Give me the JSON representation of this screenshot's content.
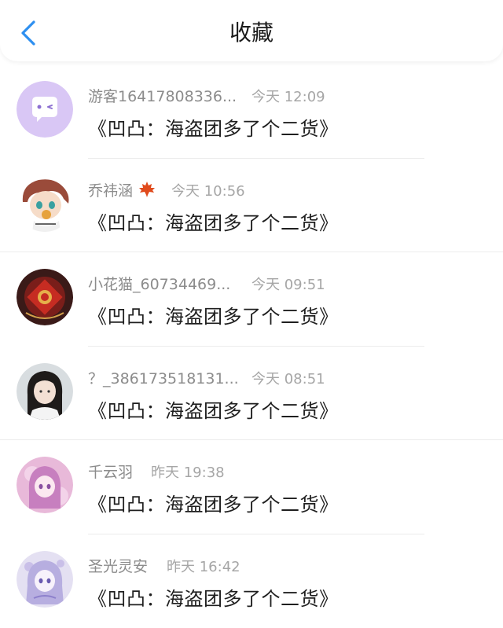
{
  "header": {
    "title": "收藏",
    "back_icon": "chevron-left-icon",
    "accent_color": "#2e8ff0"
  },
  "favorites": [
    {
      "username": "游客16417808336...",
      "time": "今天 12:09",
      "content": "《凹凸：海盗团多了个二货》",
      "avatar": "guest-chat-bubble-avatar"
    },
    {
      "username": "乔祎涵",
      "badge": "maple-leaf-icon",
      "time": "今天 10:56",
      "content": "《凹凸：海盗团多了个二货》",
      "avatar": "anime-boy-avatar"
    },
    {
      "username": "小花猫_60734469...",
      "time": "今天 09:51",
      "content": "《凹凸：海盗团多了个二货》",
      "avatar": "red-decoration-avatar"
    },
    {
      "username": "？_386173518131...",
      "time": "今天 08:51",
      "content": "《凹凸：海盗团多了个二货》",
      "avatar": "girl-photo-avatar"
    },
    {
      "username": "千云羽",
      "time": "昨天 19:38",
      "content": "《凹凸：海盗团多了个二货》",
      "avatar": "pink-anime-girl-avatar"
    },
    {
      "username": "圣光灵安",
      "time": "昨天 16:42",
      "content": "《凹凸：海盗团多了个二货》",
      "avatar": "lavender-anime-girl-avatar"
    }
  ]
}
